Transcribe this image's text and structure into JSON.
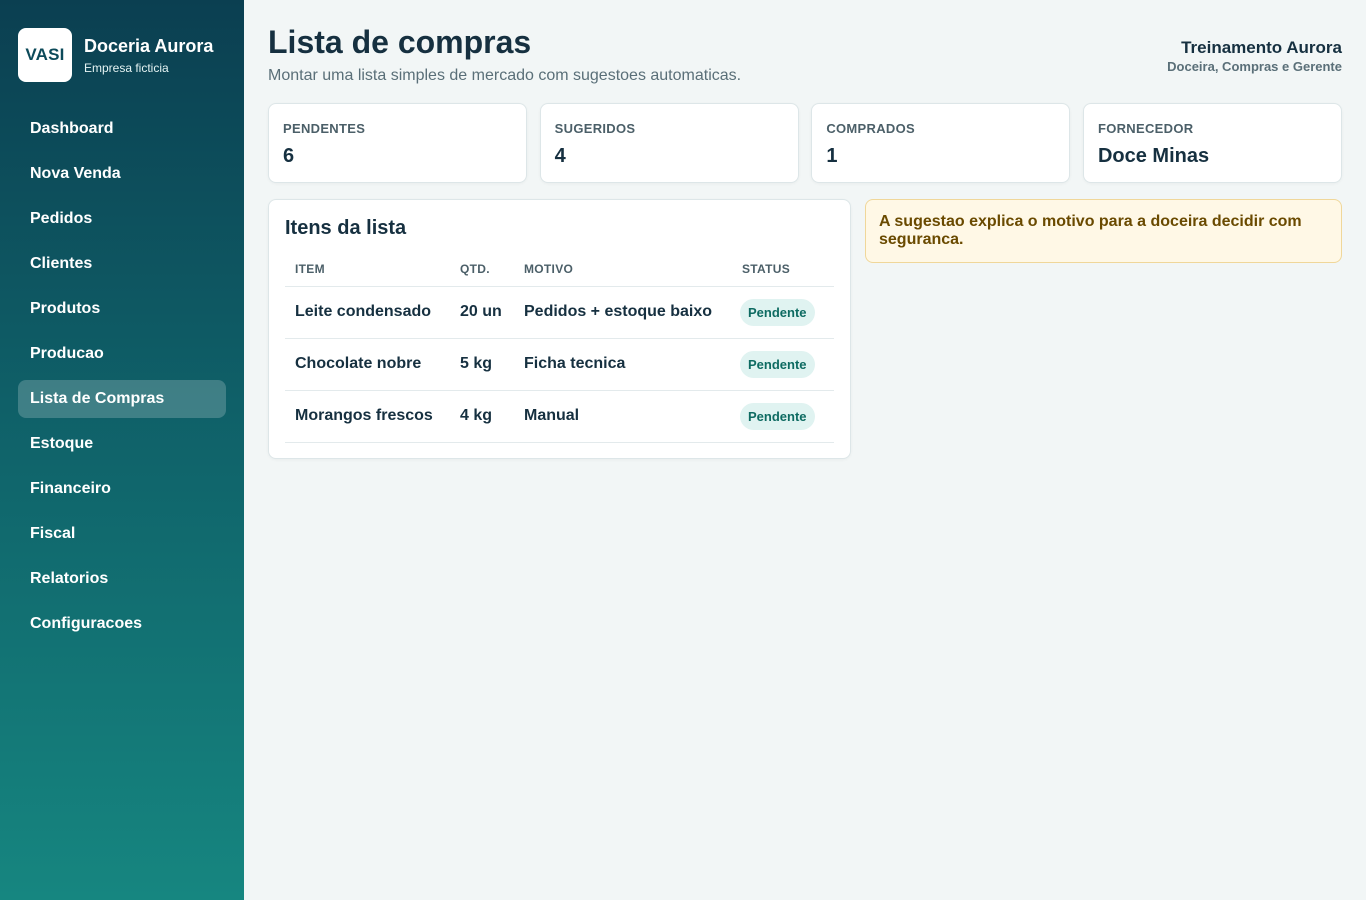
{
  "brand": {
    "logo_text": "VASI",
    "name": "Doceria Aurora",
    "subtitle": "Empresa ficticia"
  },
  "sidebar": {
    "active": "Lista de Compras",
    "items": [
      {
        "label": "Dashboard"
      },
      {
        "label": "Nova Venda"
      },
      {
        "label": "Pedidos"
      },
      {
        "label": "Clientes"
      },
      {
        "label": "Produtos"
      },
      {
        "label": "Producao"
      },
      {
        "label": "Lista de Compras"
      },
      {
        "label": "Estoque"
      },
      {
        "label": "Financeiro"
      },
      {
        "label": "Fiscal"
      },
      {
        "label": "Relatorios"
      },
      {
        "label": "Configuracoes"
      }
    ]
  },
  "header": {
    "title": "Lista de compras",
    "subtitle": "Montar uma lista simples de mercado com sugestoes automaticas."
  },
  "user": {
    "name": "Treinamento Aurora",
    "role": "Doceira, Compras e Gerente"
  },
  "stats": [
    {
      "label": "PENDENTES",
      "value": "6"
    },
    {
      "label": "SUGERIDOS",
      "value": "4"
    },
    {
      "label": "COMPRADOS",
      "value": "1"
    },
    {
      "label": "FORNECEDOR",
      "value": "Doce Minas"
    }
  ],
  "list": {
    "title": "Itens da lista",
    "columns": [
      "ITEM",
      "QTD.",
      "MOTIVO",
      "STATUS"
    ],
    "rows": [
      {
        "item": "Leite condensado",
        "qty": "20 un",
        "reason": "Pedidos + estoque baixo",
        "status": "Pendente"
      },
      {
        "item": "Chocolate nobre",
        "qty": "5 kg",
        "reason": "Ficha tecnica",
        "status": "Pendente"
      },
      {
        "item": "Morangos frescos",
        "qty": "4 kg",
        "reason": "Manual",
        "status": "Pendente"
      }
    ]
  },
  "note": {
    "text": "A sugestao explica o motivo para a doceira decidir com seguranca."
  },
  "colors": {
    "sidebar_top": "#0b3f51",
    "sidebar_bottom": "#168680",
    "badge_bg": "#e0f3f1",
    "badge_text": "#0e6b62",
    "note_bg": "#fff8e6",
    "note_border": "#f0d79a"
  }
}
